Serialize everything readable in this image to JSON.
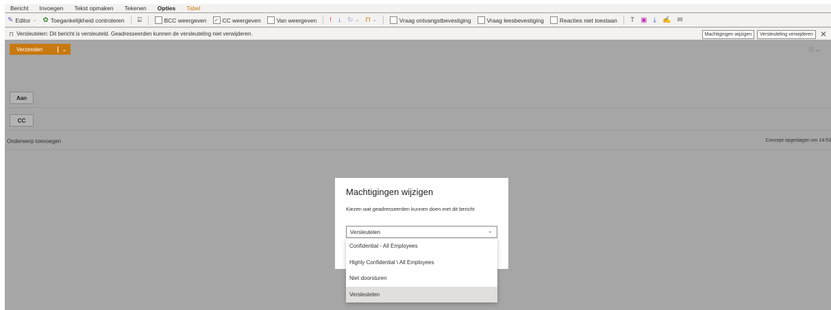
{
  "tabs": [
    "Bericht",
    "Invoegen",
    "Tekst opmaken",
    "Tekenen",
    "Opties",
    "Tabel"
  ],
  "ribbon": {
    "editor": "Editor",
    "accessibility": "Toegankelijkheid controleren",
    "bcc": "BCC weergeven",
    "cc": "CC weergeven",
    "from": "Van weergeven",
    "delivery_receipt": "Vraag ontvangstbevestiging",
    "read_receipt": "Vraag leesbevestiging",
    "no_replies": "Reacties niet toestaan"
  },
  "infobar": {
    "message": "Versleutelen: Dit bericht is versleuteld. Geadresseerden kunnen de versleuteling niet verwijderen.",
    "change_permissions": "Machtigingen wijzigen",
    "remove_encryption": "Versleuteling verwijderen"
  },
  "send_label": "Verzenden",
  "to_label": "Aan",
  "cc_label": "CC",
  "subject_placeholder": "Onderwerp toevoegen",
  "draft_status": "Concept opgeslagen om 14:53",
  "dialog": {
    "title": "Machtigingen wijzigen",
    "subtitle": "Kiezen wat geadresseerden kunnen doen met dit bericht",
    "selected": "Versleutelen",
    "options": [
      "Confidential - All Employees",
      "Highly Confidential \\ All Employees",
      "Niet doorsturen",
      "Versleutelen"
    ]
  },
  "icons": [
    "pen-icon",
    "accessibility-icon",
    "lock-icon",
    "importance-high-icon",
    "importance-low-icon",
    "help-icon"
  ],
  "colors": {
    "accent": "#c8790f",
    "overlay": "#a6a6a6"
  }
}
